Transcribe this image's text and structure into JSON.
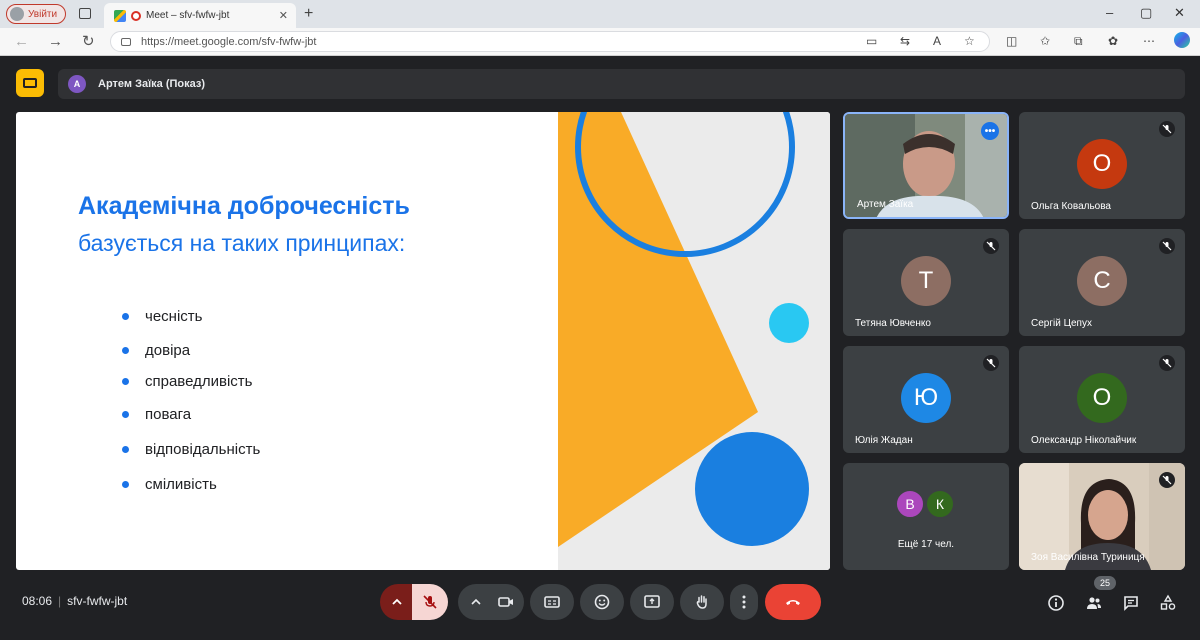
{
  "browser": {
    "profile_label": "Увійти",
    "tab_title": "Meet – sfv-fwfw-jbt",
    "tab_close": "✕",
    "new_tab": "+",
    "url": "https://meet.google.com/sfv-fwfw-jbt",
    "window_controls": [
      "–",
      "▢",
      "✕"
    ]
  },
  "meet": {
    "presenter": {
      "initial": "А",
      "label": "Артем Заїка (Показ)"
    },
    "slide": {
      "title": "Академічна доброчесність",
      "subtitle": "базується на таких принципах:",
      "bullets": [
        "чесність",
        "довіра",
        "справедливість",
        "повага",
        "відповідальність",
        "сміливість"
      ],
      "colors": {
        "accent": "#1a73e8",
        "yellow": "#f9ab27",
        "cyan": "#29c8f2",
        "blue": "#1a7fe0"
      }
    },
    "participants": [
      {
        "name": "Артем Заїка",
        "type": "video",
        "active": true
      },
      {
        "name": "Ольга Ковальова",
        "initial": "О",
        "color": "#c5390f"
      },
      {
        "name": "Тетяна Ювченко",
        "initial": "Т",
        "color": "#8d6e63"
      },
      {
        "name": "Сергій Цепух",
        "initial": "С",
        "color": "#8d6e63"
      },
      {
        "name": "Юлія Жадан",
        "initial": "Ю",
        "color": "#1e88e5"
      },
      {
        "name": "Олександр Ніколайчик",
        "initial": "О",
        "color": "#33691e"
      },
      {
        "name": "Зоя Василівна Туриниця",
        "type": "video"
      }
    ],
    "others": {
      "initials": [
        "В",
        "К"
      ],
      "colors": [
        "#ab47bc",
        "#33691e"
      ],
      "label": "Ещё 17 чел."
    },
    "controls": {
      "time": "08:06",
      "meeting_code": "sfv-fwfw-jbt",
      "participant_count": "25"
    }
  }
}
